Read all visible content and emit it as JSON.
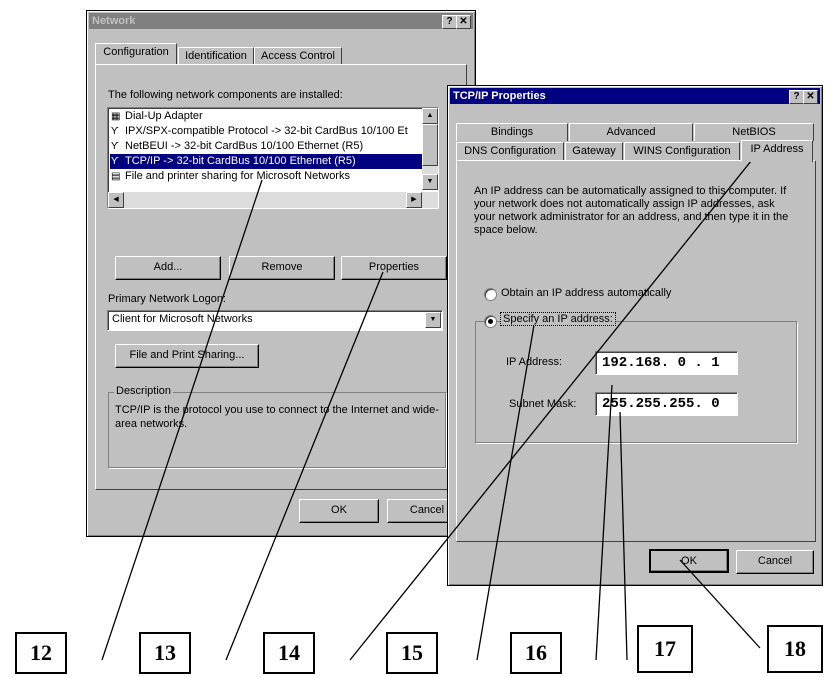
{
  "network": {
    "title": "Network",
    "tabs": [
      "Configuration",
      "Identification",
      "Access Control"
    ],
    "components_label": "The following network components are installed:",
    "components": [
      {
        "icon": "dialup-adapter-icon",
        "label": "Dial-Up Adapter"
      },
      {
        "icon": "protocol-icon",
        "label": "IPX/SPX-compatible Protocol -> 32-bit CardBus 10/100 Et"
      },
      {
        "icon": "protocol-icon",
        "label": "NetBEUI -> 32-bit CardBus 10/100 Ethernet (R5)"
      },
      {
        "icon": "protocol-icon",
        "label": "TCP/IP -> 32-bit CardBus 10/100 Ethernet (R5)"
      },
      {
        "icon": "file-sharing-icon",
        "label": "File and printer sharing for Microsoft Networks"
      }
    ],
    "selected_index": 3,
    "add_label": "Add...",
    "remove_label": "Remove",
    "properties_label": "Properties",
    "logon_label": "Primary Network Logon:",
    "logon_value": "Client for Microsoft Networks",
    "file_sharing_label": "File and Print Sharing...",
    "description_legend": "Description",
    "description_text": "TCP/IP is the protocol you use to connect to the Internet and wide-area networks.",
    "ok_label": "OK",
    "cancel_label": "Cancel"
  },
  "tcpip": {
    "title": "TCP/IP Properties",
    "tabs_back": [
      "Bindings",
      "Advanced",
      "NetBIOS"
    ],
    "tabs_front": [
      "DNS Configuration",
      "Gateway",
      "WINS Configuration",
      "IP Address"
    ],
    "intro": "An IP address can be automatically assigned to this computer. If your network does not automatically assign IP addresses, ask your network administrator for an address, and then type it in the space below.",
    "obtain_label": "Obtain an IP address automatically",
    "specify_label": "Specify an IP address:",
    "ip_label": "IP Address:",
    "ip_value": "192.168. 0 . 1",
    "mask_label": "Subnet Mask:",
    "mask_value": "255.255.255. 0",
    "ok_label": "OK",
    "cancel_label": "Cancel"
  },
  "callouts": [
    "12",
    "13",
    "14",
    "15",
    "16",
    "17",
    "18"
  ],
  "colors": {
    "title_inactive": "#808080",
    "title_active": "#000080",
    "face": "#c0c0c0"
  }
}
